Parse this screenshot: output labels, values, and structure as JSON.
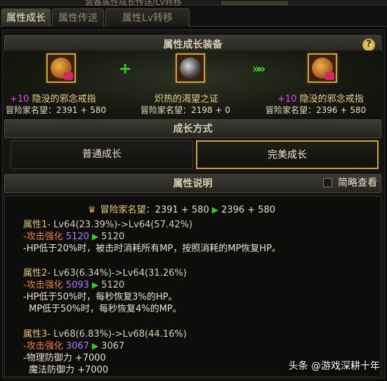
{
  "window": {
    "title": "装备属性成长传送/Lv转移"
  },
  "tabs": [
    {
      "label": "属性成长"
    },
    {
      "label": "属性传送"
    },
    {
      "label": "属性Lv转移"
    }
  ],
  "equip_section": {
    "title": "属性成长装备",
    "help": "?",
    "plus_symbol": "+",
    "arrow_symbol": "»»",
    "left_item": {
      "plus": "+10",
      "name": "隐没的邪念戒指",
      "fame": "冒险家名望：2391 + 580"
    },
    "mid_item": {
      "name": "炽热的渴望之证",
      "fame": "冒险家名望：2198 + 0"
    },
    "right_item": {
      "plus": "+10",
      "name": "隐没的邪念戒指",
      "fame": "冒险家名望：2396 + 580"
    }
  },
  "method_section": {
    "title": "成长方式",
    "normal_label": "普通成长",
    "perfect_label": "完美成长"
  },
  "desc_section": {
    "title": "属性说明",
    "simple_view_label": "简略查看",
    "fame": {
      "label": "冒险家名望",
      "from": "：2391 + 580",
      "arrow": "▶",
      "to": "2396 + 580"
    },
    "attr1": {
      "head": "属性1-",
      "lv": "Lv64(23.39%)->Lv64(57.42%)",
      "sub_label": "-攻击强化",
      "sub_from": "5120",
      "sub_to": "5120",
      "effect1": "-HP低于20%时，被击时消耗所有MP，按照消耗的MP恢复HP。"
    },
    "attr2": {
      "head": "属性2-",
      "lv": "Lv63(6.34%)->Lv64(31.26%)",
      "sub_label": "-攻击强化",
      "sub_from": "5093",
      "sub_to": "5120",
      "effect1": "-HP低于50%时，每秒恢复3%的HP。",
      "effect2": "MP低于50%时，每秒恢复4%的MP。"
    },
    "attr3": {
      "head": "属性3-",
      "lv": "Lv68(6.83%)->Lv68(44.16%)",
      "sub_label": "-攻击强化",
      "sub_from": "3067",
      "sub_to": "3067",
      "effect1": "-物理防御力 +7000",
      "effect2": "魔法防御力 +7000"
    }
  },
  "watermark": "头条 @游戏深耕十年",
  "colors": {
    "accent_gold": "#d1a432",
    "green_arrow": "#2fd21c",
    "purple_value": "#b17aff",
    "orange_label": "#e9843c"
  }
}
